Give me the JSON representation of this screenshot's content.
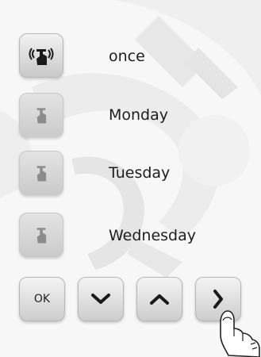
{
  "schedule": {
    "items": [
      {
        "label": "once",
        "active": true
      },
      {
        "label": "Monday",
        "active": false
      },
      {
        "label": "Tuesday",
        "active": false
      },
      {
        "label": "Wednesday",
        "active": false
      }
    ]
  },
  "nav": {
    "ok_label": "OK",
    "down_icon": "chevron-down-icon",
    "up_icon": "chevron-up-icon",
    "next_icon": "chevron-right-icon"
  },
  "colors": {
    "background": "#f6f6f6",
    "icon_active": "#1a1a1a",
    "icon_inactive": "#8c8c8c"
  }
}
